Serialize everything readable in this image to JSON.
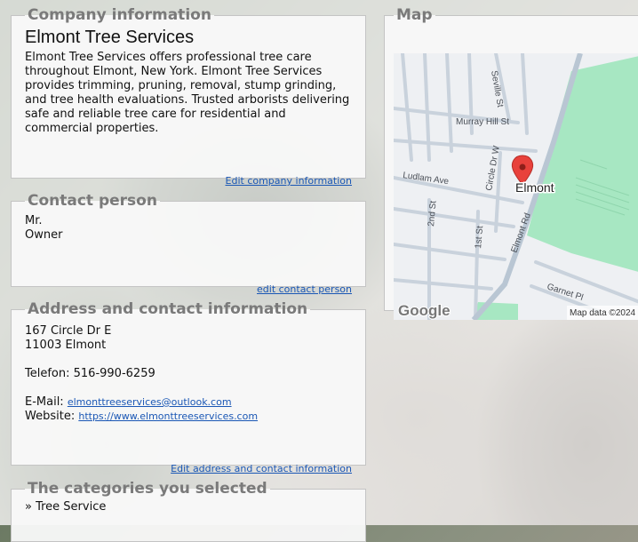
{
  "company": {
    "legend": "Company information",
    "name": "Elmont Tree Services",
    "description": "Elmont Tree Services offers professional tree care throughout Elmont, New York. Elmont Tree Services provides trimming, pruning, removal, stump grinding, and tree health evaluations. Trusted arborists delivering safe and reliable tree care for residential and commercial properties.",
    "edit_label": "Edit company information"
  },
  "contact": {
    "legend": "Contact person",
    "salutation": "Mr.",
    "role": "Owner",
    "edit_label": "edit contact person"
  },
  "address": {
    "legend": "Address and contact information",
    "street": "167 Circle Dr E",
    "zip_city": "11003 Elmont",
    "phone_label": "Telefon:",
    "phone": "516-990-6259",
    "email_label": "E-Mail:",
    "email": "elmonttreeservices@outlook.com",
    "website_label": "Website:",
    "website": "https://www.elmonttreeservices.com",
    "edit_label": "Edit address and contact information"
  },
  "categories": {
    "legend": "The categories you selected",
    "items": [
      "» Tree Service"
    ]
  },
  "map": {
    "legend": "Map",
    "place_label": "Elmont",
    "streets": {
      "seville": "Seville St",
      "murray": "Murray Hill St",
      "circle": "Circle Dr W",
      "ludlam": "Ludlam Ave",
      "second": "2nd St",
      "first": "1st St",
      "elmont_rd": "Elmont Rd",
      "garnet": "Garnet Pl"
    },
    "google_label": "Google",
    "attribution": "Map data ©2024",
    "colors": {
      "park": "#a7e7c2",
      "road": "#c3cdd8",
      "marker": "#e8413b"
    }
  }
}
